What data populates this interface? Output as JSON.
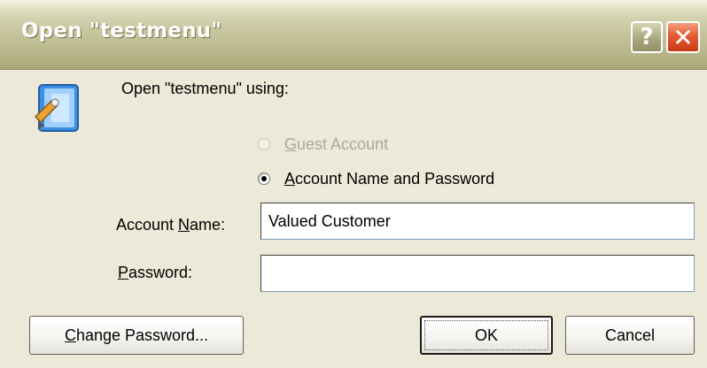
{
  "window": {
    "title": "Open \"testmenu\"",
    "help_glyph": "?",
    "close_glyph": "✕",
    "icon": "file-open-app-icon"
  },
  "dialog": {
    "intro_text": "Open \"testmenu\" using:",
    "options": [
      {
        "label_mnemonic": "G",
        "label_rest": "uest Account",
        "selected": false,
        "enabled": false
      },
      {
        "label_mnemonic": "A",
        "label_rest": "ccount Name and Password",
        "selected": true,
        "enabled": true
      }
    ],
    "account_name": {
      "label_pre": "Account ",
      "label_mnemonic": "N",
      "label_rest": "ame:",
      "value": "Valued Customer"
    },
    "password": {
      "label_mnemonic": "P",
      "label_rest": "assword:",
      "value": ""
    }
  },
  "buttons": {
    "change_password_mnemonic": "C",
    "change_password_rest": "hange Password...",
    "ok": "OK",
    "cancel": "Cancel"
  },
  "colors": {
    "dialog_bg": "#ece9d8",
    "titlebar_olive": "#b6b488",
    "close_red": "#e35b33"
  }
}
